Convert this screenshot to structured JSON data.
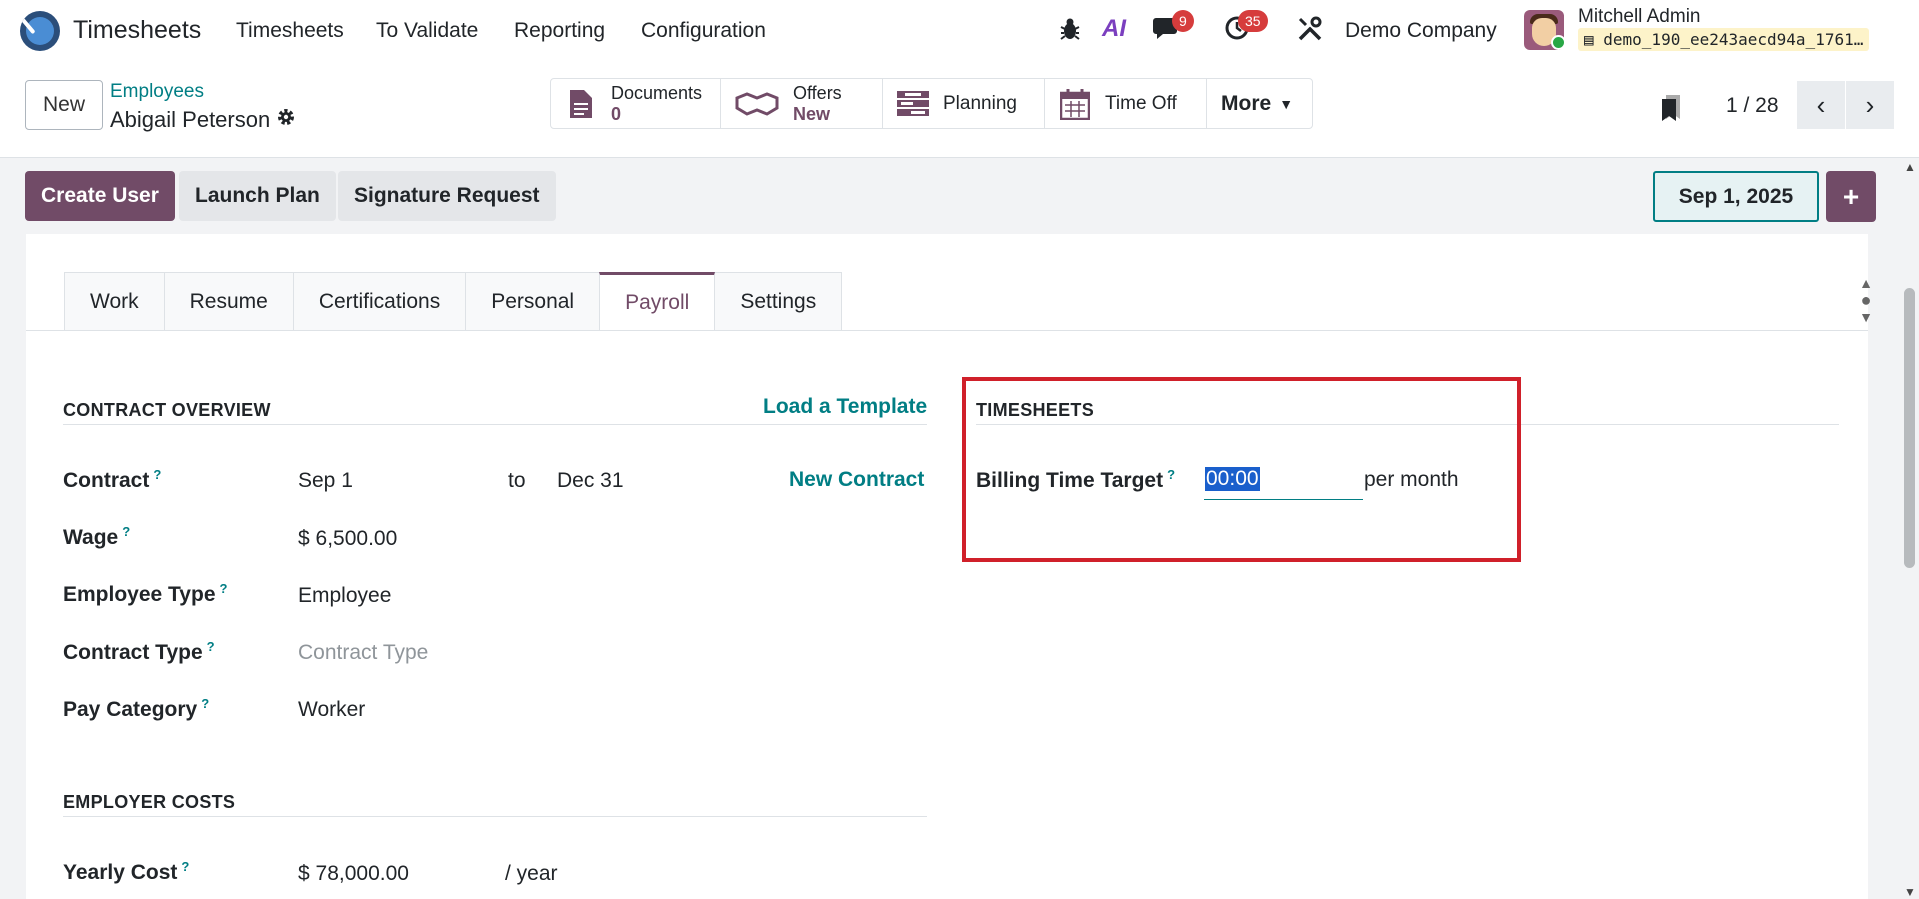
{
  "navbar": {
    "app_name": "Timesheets",
    "menu": [
      "Timesheets",
      "To Validate",
      "Reporting",
      "Configuration"
    ],
    "messages_count": "9",
    "activities_count": "35",
    "ai_label": "AI",
    "company": "Demo Company",
    "user_name": "Mitchell Admin",
    "database": "demo_190_ee243aecd94a_1761…"
  },
  "control": {
    "new_label": "New",
    "breadcrumb_parent": "Employees",
    "breadcrumb_current": "Abigail Peterson",
    "smart_buttons": {
      "documents_label": "Documents",
      "documents_value": "0",
      "offers_label": "Offers",
      "offers_value": "New",
      "planning_label": "Planning",
      "timeoff_label": "Time Off",
      "more_label": "More"
    },
    "pager": "1 / 28"
  },
  "actions": {
    "create_user": "Create User",
    "launch_plan": "Launch Plan",
    "signature_request": "Signature Request",
    "date": "Sep 1, 2025",
    "plus": "+"
  },
  "tabs": [
    "Work",
    "Resume",
    "Certifications",
    "Personal",
    "Payroll",
    "Settings"
  ],
  "active_tab": "Payroll",
  "contract_overview": {
    "title": "CONTRACT OVERVIEW",
    "load_template": "Load a Template",
    "contract_label": "Contract",
    "contract_start": "Sep 1",
    "to": "to",
    "contract_end": "Dec 31",
    "new_contract": "New Contract",
    "wage_label": "Wage",
    "wage_value": "$ 6,500.00",
    "employee_type_label": "Employee Type",
    "employee_type_value": "Employee",
    "contract_type_label": "Contract Type",
    "contract_type_placeholder": "Contract Type",
    "pay_category_label": "Pay Category",
    "pay_category_value": "Worker"
  },
  "employer_costs": {
    "title": "EMPLOYER COSTS",
    "yearly_cost_label": "Yearly Cost",
    "yearly_cost_value": "$ 78,000.00",
    "per_year": "/ year"
  },
  "timesheets": {
    "title": "TIMESHEETS",
    "billing_label": "Billing Time Target",
    "billing_value": "00:00",
    "per_month": "per month"
  },
  "help_marker": "?",
  "colors": {
    "brand": "#714b67",
    "link": "#017e84",
    "highlight": "#d0202a"
  }
}
